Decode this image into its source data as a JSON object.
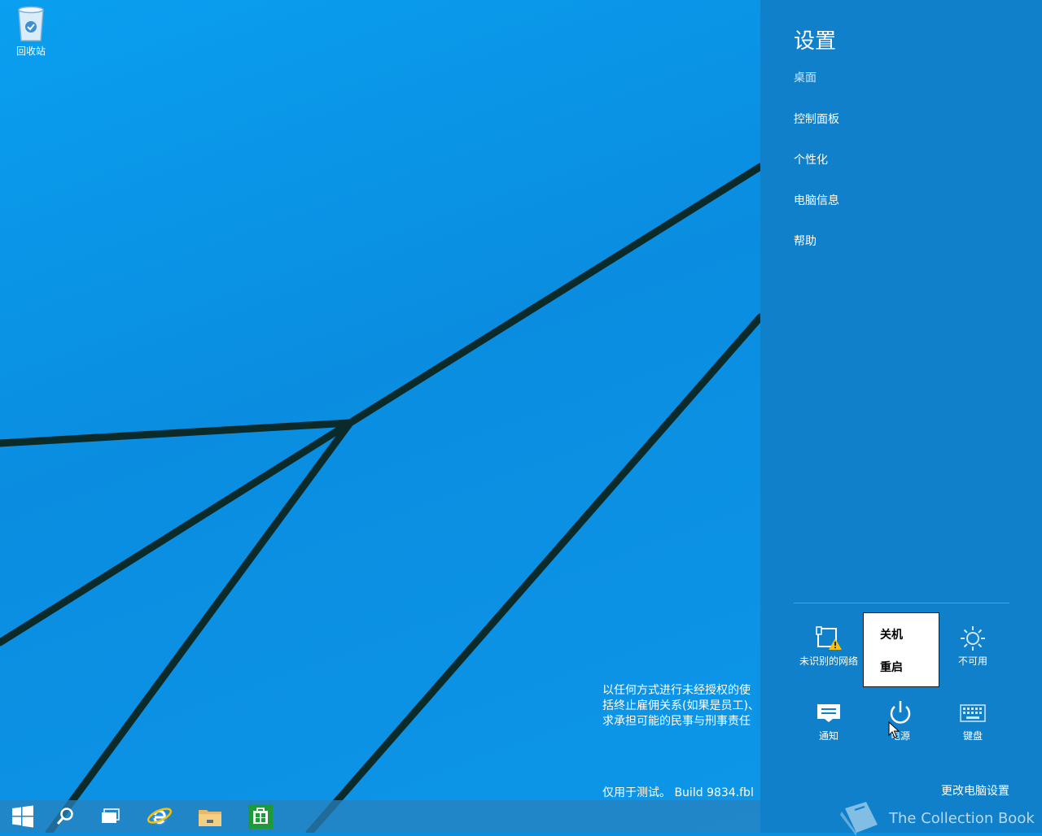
{
  "desktop": {
    "recycle_bin_label": "回收站",
    "watermark_lines": [
      "以任何方式进行未经授权的使",
      "括终止雇佣关系(如果是员工)、",
      "求承担可能的民事与刑事责任"
    ],
    "build_text": "仅用于测试。 Build 9834.fbl"
  },
  "taskbar": {
    "items": [
      "windows-start-icon",
      "search-icon",
      "task-view-icon",
      "internet-explorer-icon",
      "file-explorer-icon",
      "store-icon"
    ]
  },
  "charm": {
    "title": "设置",
    "subtitle": "桌面",
    "links": [
      "控制面板",
      "个性化",
      "电脑信息",
      "帮助"
    ],
    "tiles": {
      "network_label": "未识别的网络",
      "brightness_label": "不可用",
      "notifications_label": "通知",
      "power_label": "电源",
      "keyboard_label": "键盘"
    },
    "power_menu": {
      "shutdown_label": "关机",
      "restart_label": "重启"
    },
    "change_settings_label": "更改电脑设置",
    "watermark_brand": "The Collection Book"
  },
  "colors": {
    "charm_bg": "#0f80c9",
    "desktop_bg": "#0a8fe0",
    "taskbar_bg": "#2882be"
  }
}
